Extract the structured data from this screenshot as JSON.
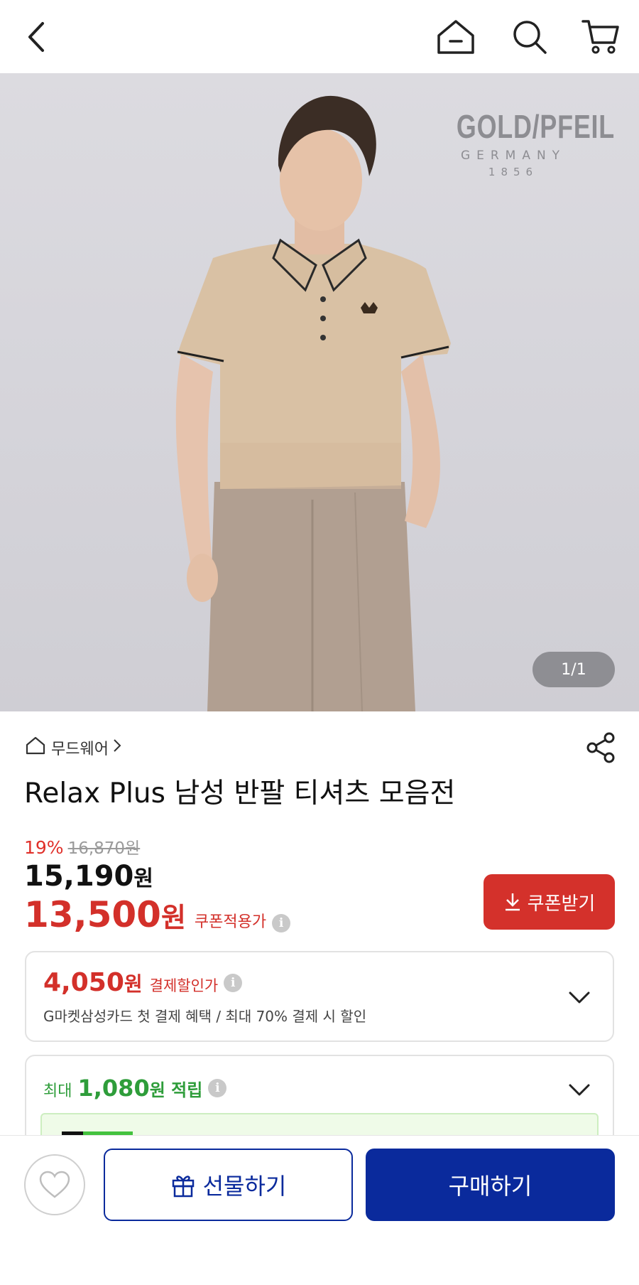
{
  "header": {
    "back_icon": "back-arrow-icon",
    "home_icon": "home-icon",
    "search_icon": "search-icon",
    "cart_icon": "cart-icon"
  },
  "hero": {
    "brand_line1": "GOLD/PFEIL",
    "brand_line2": "GERMANY",
    "brand_line3": "1856",
    "counter": "1/1"
  },
  "product": {
    "breadcrumb": "무드웨어",
    "title": "Relax Plus 남성 반팔 티셔츠 모음전",
    "discount_rate": "19%",
    "original_price": "16,870원",
    "price_value": "15,190",
    "price_unit": "원",
    "coupon_price_value": "13,500",
    "coupon_price_unit": "원",
    "coupon_price_label": "쿠폰적용가",
    "coupon_button": "쿠폰받기"
  },
  "payment_card": {
    "amount": "4,050",
    "unit": "원",
    "label": "결제할인가",
    "description": "G마켓삼성카드 첫 결제 혜택 / 최대 70% 결제 시 할인"
  },
  "points_card": {
    "prefix": "최대",
    "amount": "1,080",
    "unit": "원 적립"
  },
  "bottom": {
    "gift_button": "선물하기",
    "buy_button": "구매하기"
  },
  "colors": {
    "accent_red": "#d4312b",
    "primary_blue": "#0a2a9c",
    "points_green": "#2e9d3a"
  }
}
